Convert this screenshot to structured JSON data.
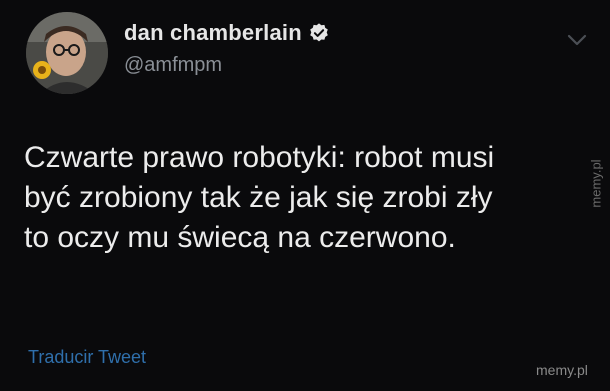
{
  "tweet": {
    "display_name": "dan chamberlain",
    "handle": "@amfmpm",
    "text_lines": [
      "Czwarte prawo robotyki: robot musi",
      "być zrobiony tak że jak się zrobi zły",
      "to oczy mu świecą na czerwono."
    ],
    "translate_label": "Traducir Tweet"
  },
  "icons": {
    "verified": "verified-badge-icon",
    "menu": "chevron-down-icon"
  },
  "colors": {
    "background": "#0a0a0c",
    "text": "#ececec",
    "muted": "#8a8f96",
    "link": "#2f6fab"
  },
  "watermarks": {
    "side": "memy.pl",
    "corner": "memy.pl"
  }
}
